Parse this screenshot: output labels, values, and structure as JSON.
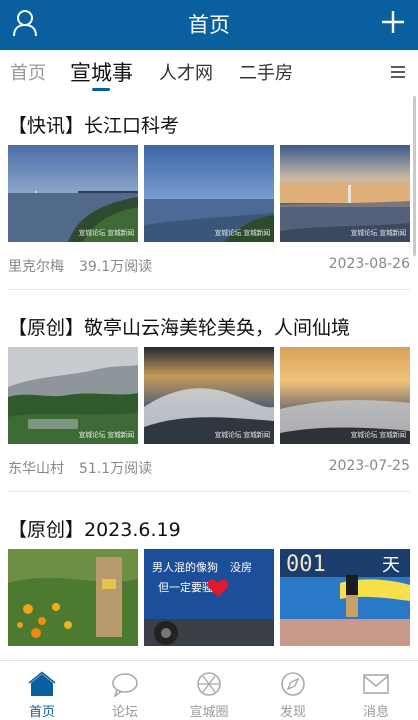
{
  "header": {
    "title": "首页",
    "left_icon": "user-icon",
    "right_icon": "plus-icon"
  },
  "tabs": [
    {
      "label": "首页"
    },
    {
      "label": "宣城事"
    },
    {
      "label": "人才网"
    },
    {
      "label": "二手房"
    }
  ],
  "tabs_menu_icon": "menu-icon",
  "watermark": "宣城论坛 宣城新闻",
  "feed": [
    {
      "title": "【快讯】长江口科考",
      "author": "里克尔梅",
      "reads": "39.1万阅读",
      "date": "2023-08-26"
    },
    {
      "title": "【原创】敬亭山云海美轮美奂，人间仙境",
      "author": "东华山村",
      "reads": "51.1万阅读",
      "date": "2023-07-25"
    },
    {
      "title": "【原创】2023.6.19",
      "author": "",
      "reads": "",
      "date": ""
    }
  ],
  "thumb_text": {
    "truck_line1": "男人混的像狗",
    "truck_line2": "但一定要骚",
    "truck_mark": "没房",
    "board_digits": "001",
    "board_char": "天"
  },
  "bottom_nav": [
    {
      "label": "首页",
      "icon": "home-icon"
    },
    {
      "label": "论坛",
      "icon": "chat-bubble-icon"
    },
    {
      "label": "宣城圈",
      "icon": "aperture-icon"
    },
    {
      "label": "发现",
      "icon": "compass-icon"
    },
    {
      "label": "消息",
      "icon": "mail-icon"
    }
  ],
  "colors": {
    "brand": "#0a5fa0",
    "muted": "#888888"
  }
}
